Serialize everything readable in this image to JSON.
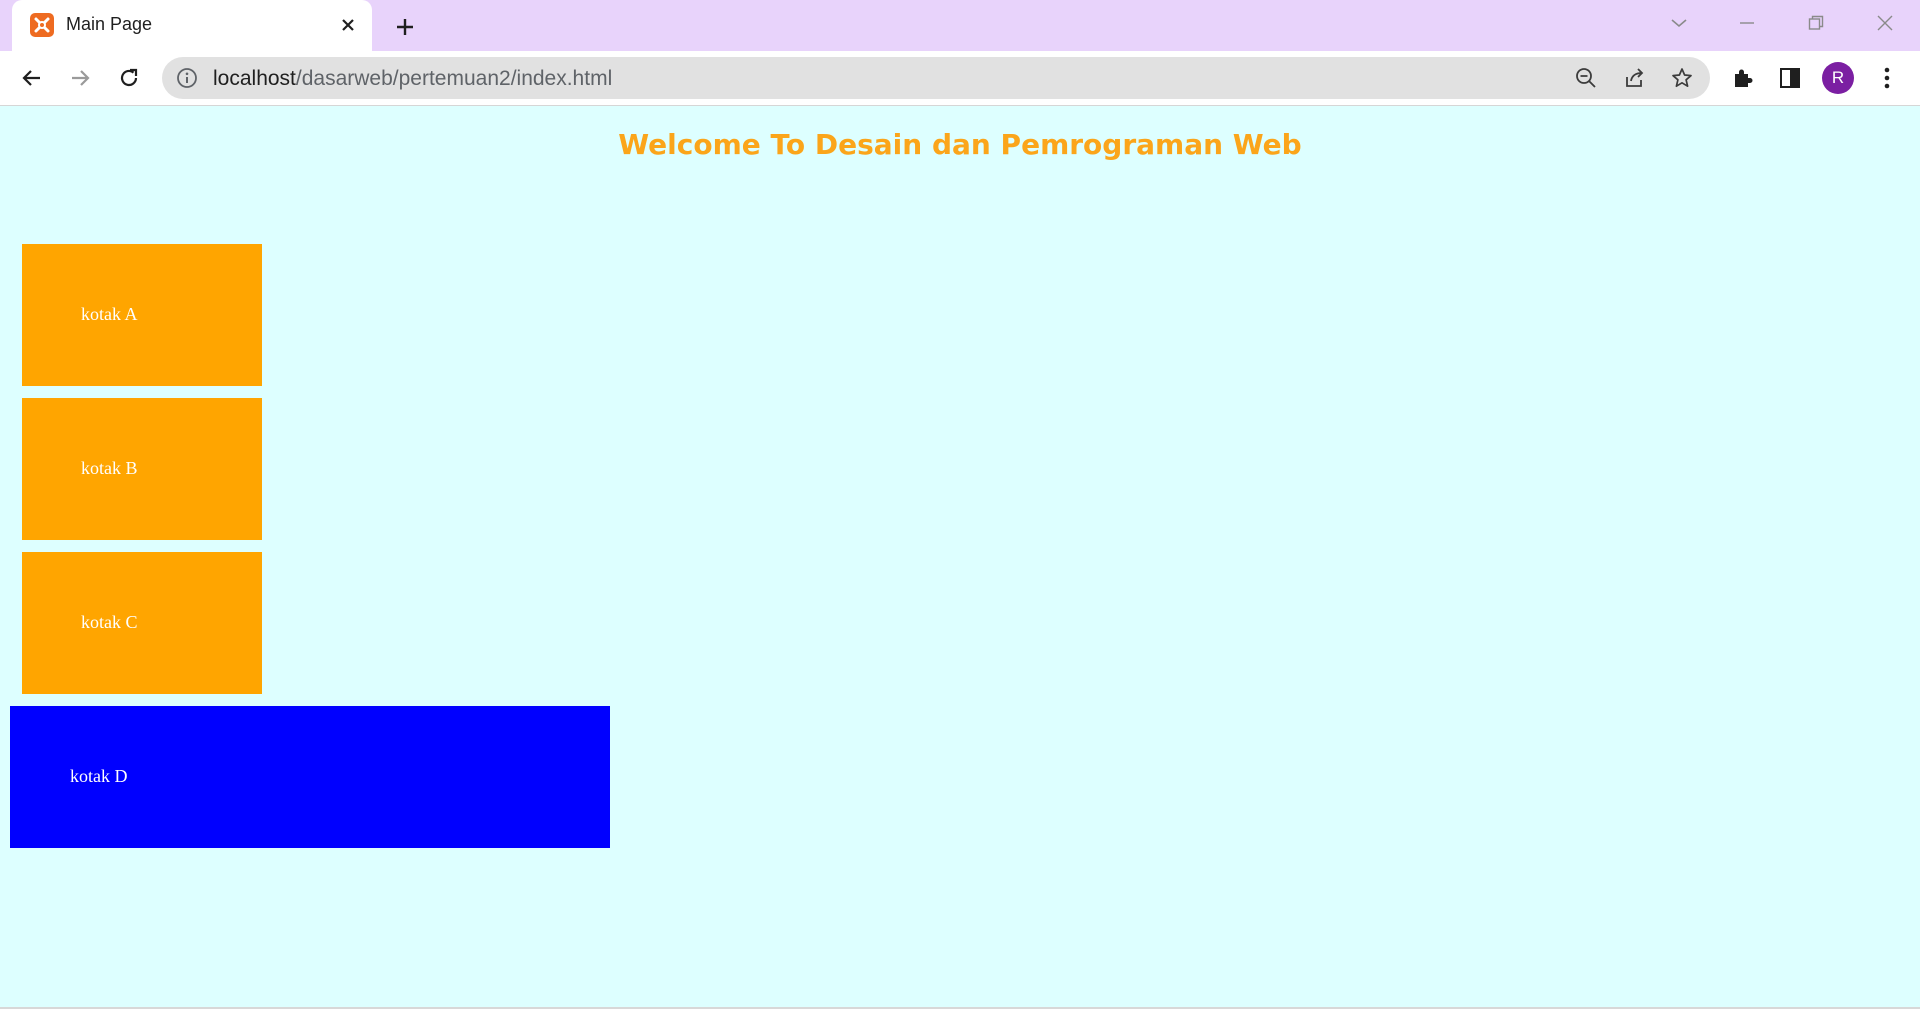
{
  "browser": {
    "tab_title": "Main Page",
    "url_host": "localhost",
    "url_path": "/dasarweb/pertemuan2/index.html",
    "profile_initial": "R"
  },
  "page": {
    "heading": "Welcome To Desain dan Pemrograman Web",
    "boxes": [
      {
        "label": "kotak A",
        "color": "#ffa500"
      },
      {
        "label": "kotak B",
        "color": "#ffa500"
      },
      {
        "label": "kotak C",
        "color": "#ffa500"
      },
      {
        "label": "kotak D",
        "color": "#0000ff"
      }
    ],
    "background_color": "#ddffff",
    "heading_color": "#fba51a"
  }
}
